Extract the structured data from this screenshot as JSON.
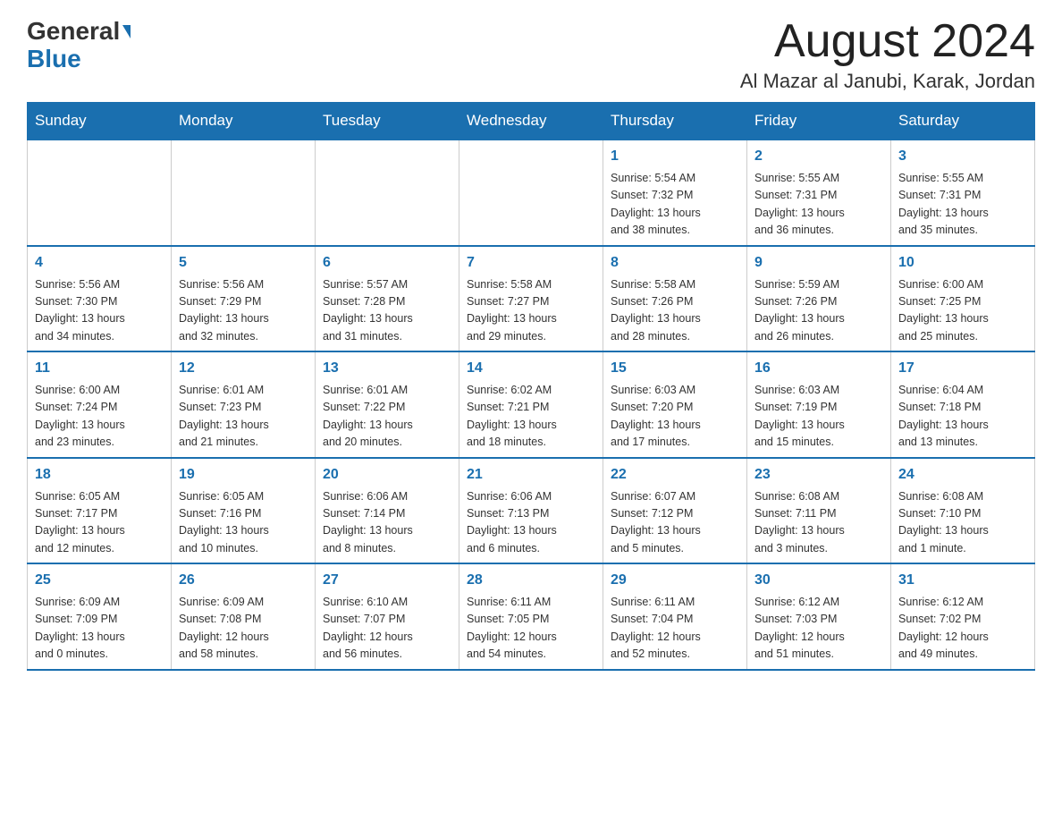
{
  "header": {
    "logo_line1": "General",
    "logo_line2": "Blue",
    "month_title": "August 2024",
    "location": "Al Mazar al Janubi, Karak, Jordan"
  },
  "days_of_week": [
    "Sunday",
    "Monday",
    "Tuesday",
    "Wednesday",
    "Thursday",
    "Friday",
    "Saturday"
  ],
  "weeks": [
    {
      "days": [
        {
          "number": "",
          "info": ""
        },
        {
          "number": "",
          "info": ""
        },
        {
          "number": "",
          "info": ""
        },
        {
          "number": "",
          "info": ""
        },
        {
          "number": "1",
          "info": "Sunrise: 5:54 AM\nSunset: 7:32 PM\nDaylight: 13 hours\nand 38 minutes."
        },
        {
          "number": "2",
          "info": "Sunrise: 5:55 AM\nSunset: 7:31 PM\nDaylight: 13 hours\nand 36 minutes."
        },
        {
          "number": "3",
          "info": "Sunrise: 5:55 AM\nSunset: 7:31 PM\nDaylight: 13 hours\nand 35 minutes."
        }
      ]
    },
    {
      "days": [
        {
          "number": "4",
          "info": "Sunrise: 5:56 AM\nSunset: 7:30 PM\nDaylight: 13 hours\nand 34 minutes."
        },
        {
          "number": "5",
          "info": "Sunrise: 5:56 AM\nSunset: 7:29 PM\nDaylight: 13 hours\nand 32 minutes."
        },
        {
          "number": "6",
          "info": "Sunrise: 5:57 AM\nSunset: 7:28 PM\nDaylight: 13 hours\nand 31 minutes."
        },
        {
          "number": "7",
          "info": "Sunrise: 5:58 AM\nSunset: 7:27 PM\nDaylight: 13 hours\nand 29 minutes."
        },
        {
          "number": "8",
          "info": "Sunrise: 5:58 AM\nSunset: 7:26 PM\nDaylight: 13 hours\nand 28 minutes."
        },
        {
          "number": "9",
          "info": "Sunrise: 5:59 AM\nSunset: 7:26 PM\nDaylight: 13 hours\nand 26 minutes."
        },
        {
          "number": "10",
          "info": "Sunrise: 6:00 AM\nSunset: 7:25 PM\nDaylight: 13 hours\nand 25 minutes."
        }
      ]
    },
    {
      "days": [
        {
          "number": "11",
          "info": "Sunrise: 6:00 AM\nSunset: 7:24 PM\nDaylight: 13 hours\nand 23 minutes."
        },
        {
          "number": "12",
          "info": "Sunrise: 6:01 AM\nSunset: 7:23 PM\nDaylight: 13 hours\nand 21 minutes."
        },
        {
          "number": "13",
          "info": "Sunrise: 6:01 AM\nSunset: 7:22 PM\nDaylight: 13 hours\nand 20 minutes."
        },
        {
          "number": "14",
          "info": "Sunrise: 6:02 AM\nSunset: 7:21 PM\nDaylight: 13 hours\nand 18 minutes."
        },
        {
          "number": "15",
          "info": "Sunrise: 6:03 AM\nSunset: 7:20 PM\nDaylight: 13 hours\nand 17 minutes."
        },
        {
          "number": "16",
          "info": "Sunrise: 6:03 AM\nSunset: 7:19 PM\nDaylight: 13 hours\nand 15 minutes."
        },
        {
          "number": "17",
          "info": "Sunrise: 6:04 AM\nSunset: 7:18 PM\nDaylight: 13 hours\nand 13 minutes."
        }
      ]
    },
    {
      "days": [
        {
          "number": "18",
          "info": "Sunrise: 6:05 AM\nSunset: 7:17 PM\nDaylight: 13 hours\nand 12 minutes."
        },
        {
          "number": "19",
          "info": "Sunrise: 6:05 AM\nSunset: 7:16 PM\nDaylight: 13 hours\nand 10 minutes."
        },
        {
          "number": "20",
          "info": "Sunrise: 6:06 AM\nSunset: 7:14 PM\nDaylight: 13 hours\nand 8 minutes."
        },
        {
          "number": "21",
          "info": "Sunrise: 6:06 AM\nSunset: 7:13 PM\nDaylight: 13 hours\nand 6 minutes."
        },
        {
          "number": "22",
          "info": "Sunrise: 6:07 AM\nSunset: 7:12 PM\nDaylight: 13 hours\nand 5 minutes."
        },
        {
          "number": "23",
          "info": "Sunrise: 6:08 AM\nSunset: 7:11 PM\nDaylight: 13 hours\nand 3 minutes."
        },
        {
          "number": "24",
          "info": "Sunrise: 6:08 AM\nSunset: 7:10 PM\nDaylight: 13 hours\nand 1 minute."
        }
      ]
    },
    {
      "days": [
        {
          "number": "25",
          "info": "Sunrise: 6:09 AM\nSunset: 7:09 PM\nDaylight: 13 hours\nand 0 minutes."
        },
        {
          "number": "26",
          "info": "Sunrise: 6:09 AM\nSunset: 7:08 PM\nDaylight: 12 hours\nand 58 minutes."
        },
        {
          "number": "27",
          "info": "Sunrise: 6:10 AM\nSunset: 7:07 PM\nDaylight: 12 hours\nand 56 minutes."
        },
        {
          "number": "28",
          "info": "Sunrise: 6:11 AM\nSunset: 7:05 PM\nDaylight: 12 hours\nand 54 minutes."
        },
        {
          "number": "29",
          "info": "Sunrise: 6:11 AM\nSunset: 7:04 PM\nDaylight: 12 hours\nand 52 minutes."
        },
        {
          "number": "30",
          "info": "Sunrise: 6:12 AM\nSunset: 7:03 PM\nDaylight: 12 hours\nand 51 minutes."
        },
        {
          "number": "31",
          "info": "Sunrise: 6:12 AM\nSunset: 7:02 PM\nDaylight: 12 hours\nand 49 minutes."
        }
      ]
    }
  ]
}
